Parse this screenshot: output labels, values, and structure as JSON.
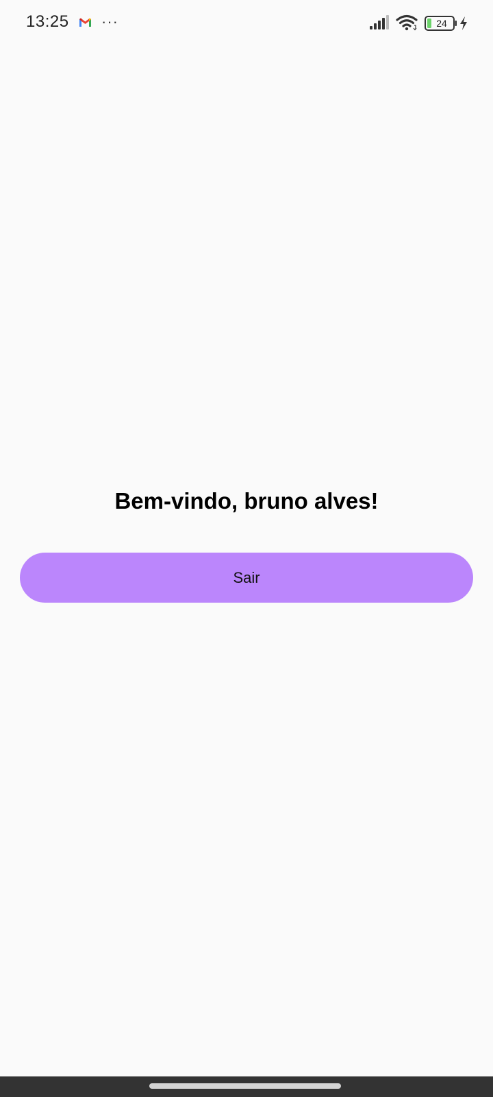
{
  "status_bar": {
    "time": "13:25",
    "notification_icons": [
      "gmail-icon",
      "more-icon"
    ],
    "more_glyph": "···",
    "battery_level": "24",
    "battery_color": "#6dd36b",
    "charging": true
  },
  "main": {
    "welcome_text": "Bem-vindo, bruno alves!",
    "logout_label": "Sair"
  },
  "colors": {
    "background": "#fafafa",
    "button": "#bb86fc",
    "nav_bar": "#333333"
  }
}
